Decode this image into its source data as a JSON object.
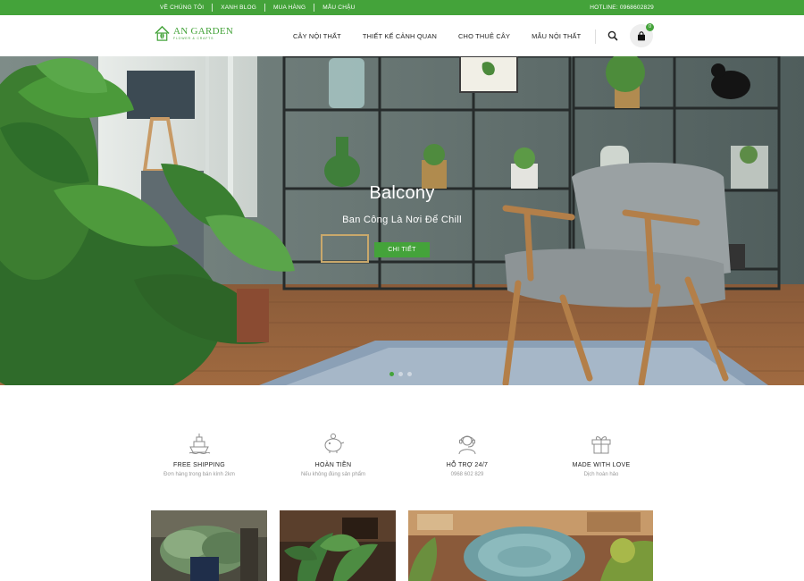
{
  "topbar": {
    "links": [
      "VỀ CHÚNG TÔI",
      "XANH BLOG",
      "MUA HÀNG",
      "MẪU CHẬU"
    ],
    "hotline": "HOTLINE: 0968602829"
  },
  "brand": {
    "name": "AN GARDEN",
    "tagline": "FLOWER & CRAFTS",
    "accent_color": "#44a33a"
  },
  "nav": {
    "items": [
      "CÂY NỘI THẤT",
      "THIẾT KẾ CẢNH QUAN",
      "CHO THUÊ CÂY",
      "MẪU NỘI THẤT"
    ]
  },
  "header": {
    "search_icon": "search-icon",
    "cart_icon": "shopping-bag-icon",
    "cart_count": "0"
  },
  "hero": {
    "title": "Balcony",
    "subtitle": "Ban Công Là Nơi Để Chill",
    "cta": "CHI TIẾT",
    "active_slide": 1,
    "slide_count": 3
  },
  "features": [
    {
      "icon": "ship-icon",
      "title": "FREE SHIPPING",
      "desc": "Đơn hàng trong bán kính 2km"
    },
    {
      "icon": "piggy-bank-icon",
      "title": "HOÀN TIỀN",
      "desc": "Nếu không đúng sản phẩm"
    },
    {
      "icon": "support-agent-icon",
      "title": "HỖ TRỢ 24/7",
      "desc": "0968 602 829"
    },
    {
      "icon": "gift-icon",
      "title": "MADE WITH LOVE",
      "desc": "Dịch hoàn hảo"
    }
  ]
}
